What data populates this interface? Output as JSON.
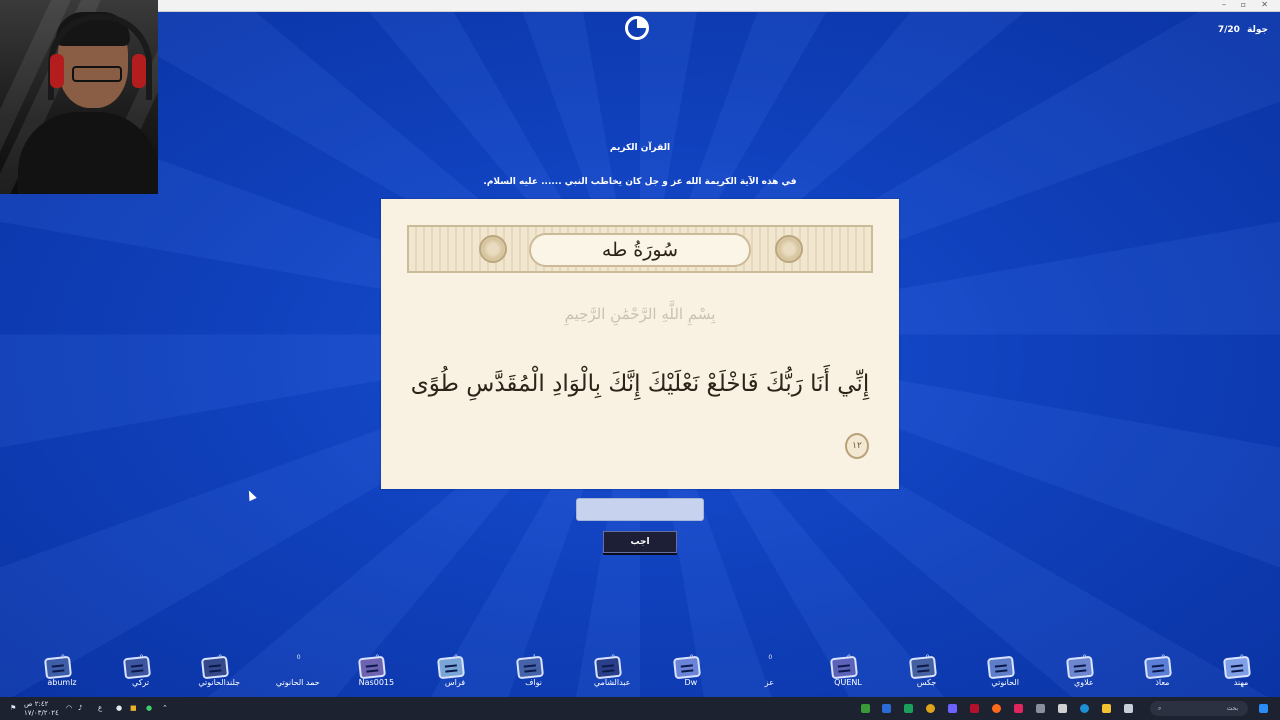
{
  "game": {
    "round_label": "جولة",
    "round_value": "7/20",
    "category": "القرآن الكريم",
    "question": "في هذه الآية الكريمة الله عز و جل كان يخاطب النبي ...... عليه السلام.",
    "answer_placeholder": "",
    "submit_label": "اجب"
  },
  "verse_card": {
    "surah_title": "سُورَةُ طه",
    "basmala": "بِسْمِ اللَّهِ الرَّحْمَٰنِ الرَّحِيمِ",
    "ayah_text": "إِنِّي أَنَا رَبُّكَ فَاخْلَعْ نَعْلَيْكَ إِنَّكَ بِالْوَادِ الْمُقَدَّسِ طُوًى",
    "ayah_number": "١٢"
  },
  "players": [
    {
      "name": "مهند",
      "score": "0",
      "color": "#7fa0e6"
    },
    {
      "name": "معاذ",
      "score": "0",
      "color": "#5b7fd6"
    },
    {
      "name": "علاوي",
      "score": "0",
      "color": "#6d86d0"
    },
    {
      "name": "الحانوتي",
      "score": "",
      "color": "#5f7ec9"
    },
    {
      "name": "جكس",
      "score": "0",
      "color": "#46619f"
    },
    {
      "name": "QUENL",
      "score": "0",
      "color": "#5b62b8"
    },
    {
      "name": "عز",
      "score": "0",
      "color": ""
    },
    {
      "name": "Dw",
      "score": "0",
      "color": "#6b84d8"
    },
    {
      "name": "عبدالشامي",
      "score": "0",
      "color": "#2a3f8a"
    },
    {
      "name": "نواف",
      "score": "1",
      "color": "#4563a8"
    },
    {
      "name": "فراس",
      "score": "0",
      "color": "#79a6d6"
    },
    {
      "name": "Nas0015",
      "score": "0",
      "color": "#6d63b0"
    },
    {
      "name": "حمد الحانوتي",
      "score": "0",
      "color": ""
    },
    {
      "name": "جلندالحانوتي",
      "score": "0",
      "color": "#35488a"
    },
    {
      "name": "تركي",
      "score": "0",
      "color": "#3c56a0"
    },
    {
      "name": "abumlz",
      "score": "0",
      "color": "#3f5ea8"
    }
  ],
  "taskbar": {
    "search_placeholder": "بحث",
    "clock_time": "٢:٤٢ ص",
    "clock_date": "١٧/٠٣/٢٠٢٤",
    "lang": "ع"
  },
  "colors": {
    "background": "#1042c2",
    "card": "#f9f1e2",
    "submit_button": "#1d1f36",
    "answer_field": "#c7d3ee"
  }
}
